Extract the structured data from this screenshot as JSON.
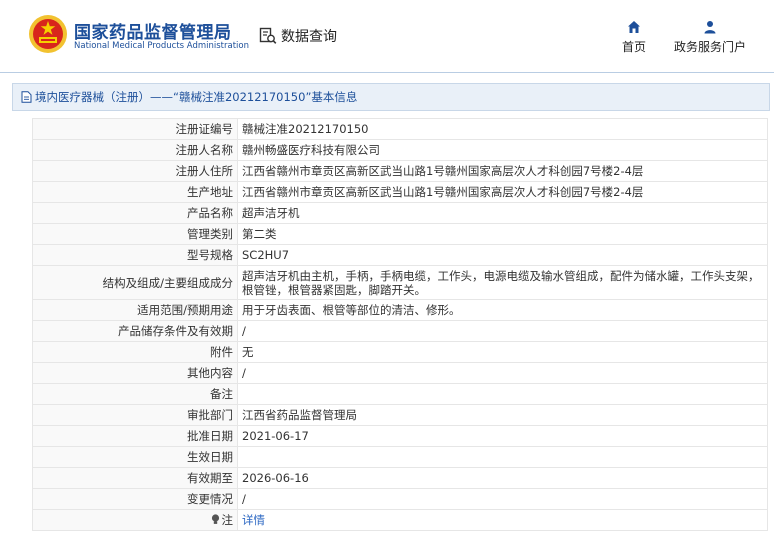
{
  "header": {
    "brand_cn": "国家药品监督管理局",
    "brand_en": "National Medical Products Administration",
    "query_label": "数据查询",
    "nav": [
      {
        "label": "首页",
        "icon": "home-icon"
      },
      {
        "label": "政务服务门户",
        "icon": "user-icon"
      }
    ]
  },
  "breadcrumb": {
    "text": "境内医疗器械（注册）——“赣械注准20212170150”基本信息"
  },
  "details": [
    {
      "label": "注册证编号",
      "value": "赣械注准20212170150"
    },
    {
      "label": "注册人名称",
      "value": "赣州畅盛医疗科技有限公司"
    },
    {
      "label": "注册人住所",
      "value": "江西省赣州市章贡区高新区武当山路1号赣州国家高层次人才科创园7号楼2-4层"
    },
    {
      "label": "生产地址",
      "value": "江西省赣州市章贡区高新区武当山路1号赣州国家高层次人才科创园7号楼2-4层"
    },
    {
      "label": "产品名称",
      "value": "超声洁牙机"
    },
    {
      "label": "管理类别",
      "value": "第二类"
    },
    {
      "label": "型号规格",
      "value": "SC2HU7"
    },
    {
      "label": "结构及组成/主要组成成分",
      "value": "超声洁牙机由主机，手柄，手柄电缆，工作头，电源电缆及输水管组成，配件为储水罐，工作头支架，根管锉，根管器紧固匙，脚踏开关。"
    },
    {
      "label": "适用范围/预期用途",
      "value": "用于牙齿表面、根管等部位的清洁、修形。"
    },
    {
      "label": "产品储存条件及有效期",
      "value": "/"
    },
    {
      "label": "附件",
      "value": "无"
    },
    {
      "label": "其他内容",
      "value": "/"
    },
    {
      "label": "备注",
      "value": ""
    },
    {
      "label": "审批部门",
      "value": "江西省药品监督管理局"
    },
    {
      "label": "批准日期",
      "value": "2021-06-17"
    },
    {
      "label": "生效日期",
      "value": ""
    },
    {
      "label": "有效期至",
      "value": "2026-06-16"
    },
    {
      "label": "变更情况",
      "value": "/"
    },
    {
      "label": "注",
      "value": "详情"
    }
  ],
  "colors": {
    "brand_blue": "#1d4f9a",
    "link_blue": "#2a66c2",
    "crumb_bg": "#e9f0f8"
  }
}
